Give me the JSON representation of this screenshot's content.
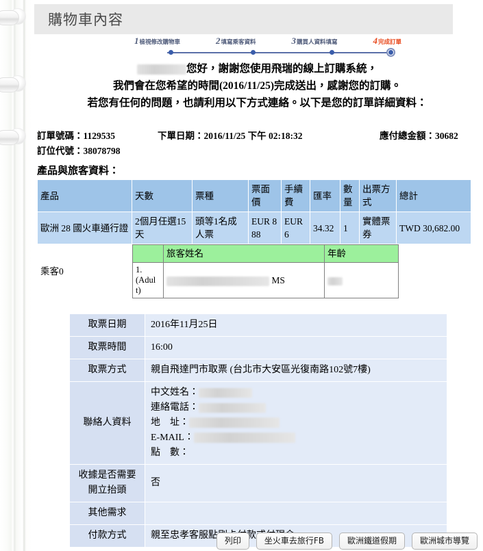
{
  "page": {
    "title": "購物車內容"
  },
  "steps": [
    {
      "num": "1",
      "label": "檢視修改購物車",
      "active": false
    },
    {
      "num": "2",
      "label": "填寫乘客資料",
      "active": false
    },
    {
      "num": "3",
      "label": "購買人資料填寫",
      "active": false
    },
    {
      "num": "4",
      "label": "完成訂單",
      "active": true
    }
  ],
  "greeting": {
    "name_redacted": "",
    "line1_after_name": "您好，謝謝您使用飛瑞的線上訂購系統，",
    "line2": "我們會在您希望的時間(2016/11/25)完成送出，感謝您的訂購。",
    "line3": "若您有任何的問題，也請利用以下方式連絡。以下是您的訂單詳細資料："
  },
  "order_meta": {
    "order_no_label": "訂單號碼：",
    "order_no_value": "1129535",
    "order_date_label": "下單日期：",
    "order_date_value": "2016/11/25 下午 02:18:32",
    "total_label": "應付總金額：",
    "total_value": "30682",
    "booking_code_label": "訂位代號：",
    "booking_code_value": "38078798"
  },
  "section_heading": "產品與旅客資料：",
  "product_table": {
    "headers": [
      "產品",
      "天數",
      "票種",
      "票面價",
      "手續費",
      "匯率",
      "數量",
      "出票方式",
      "總計"
    ],
    "rows": [
      {
        "product": "歐洲 28 國火車通行證",
        "days": "2個月任選15天",
        "ticket_type": "頭等1名成人票",
        "face_price": "EUR 888",
        "fee": "EUR 6",
        "rate": "34.32",
        "qty": "1",
        "issue_method": "實體票券",
        "total": "TWD 30,682.00"
      }
    ]
  },
  "passenger": {
    "group_label": "乘客0",
    "headers": [
      "",
      "旅客姓名",
      "年齡"
    ],
    "rows": [
      {
        "index": "1.",
        "index_type": "(Adult)",
        "name_redacted": "",
        "name_suffix": "MS",
        "age_redacted": ""
      }
    ]
  },
  "details": {
    "pickup_date_label": "取票日期",
    "pickup_date_value": "2016年11月25日",
    "pickup_time_label": "取票時間",
    "pickup_time_value": "16:00",
    "pickup_method_label": "取票方式",
    "pickup_method_value": "親自飛達門市取票 (台北市大安區光復南路102號7樓)",
    "contact_label": "聯絡人資料",
    "contact": {
      "name_key": "中文姓名：",
      "phone_key": "連絡電話：",
      "address_key": "地　址：",
      "email_key": "E-MAIL：",
      "points_key": "點　數：",
      "points_value": ""
    },
    "receipt_label": "收據是否需要開立抬頭",
    "receipt_value": "否",
    "other_label": "其他需求",
    "other_value": "",
    "payment_label": "付款方式",
    "payment_value": "親至忠孝客服點刷卡付款或付現金"
  },
  "buttons": [
    {
      "label": "列印"
    },
    {
      "label": "坐火車去旅行FB"
    },
    {
      "label": "歐洲鐵道假期"
    },
    {
      "label": "歐洲城市導覽"
    }
  ],
  "colors": {
    "header_blue": "#9ec4e8",
    "row_blue": "#bdd7f2",
    "detail_blue": "#dfe8f6",
    "green": "#9cf09c",
    "active_step": "#e8491d",
    "step_blue": "#4f5b7a"
  }
}
